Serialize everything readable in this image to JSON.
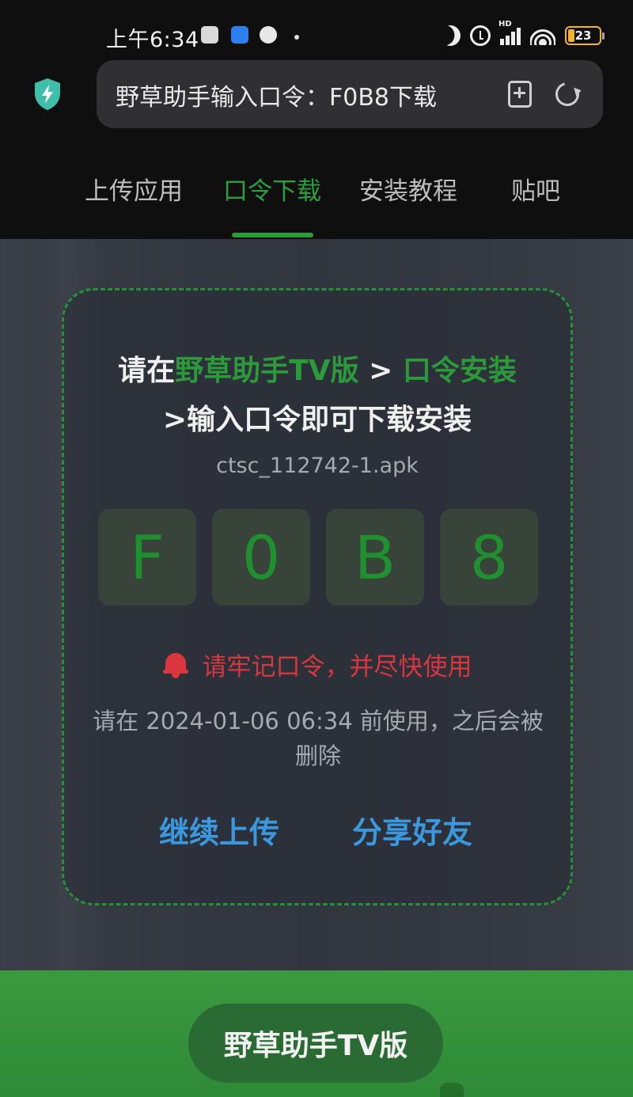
{
  "status_bar": {
    "time": "上午6:34",
    "battery": "23",
    "network": "HD"
  },
  "browser": {
    "url_text": "野草助手输入口令：F0B8下载"
  },
  "tabs": [
    {
      "label": "上传应用",
      "active": false
    },
    {
      "label": "口令下载",
      "active": true
    },
    {
      "label": "安装教程",
      "active": false
    },
    {
      "label": "贴吧",
      "active": false
    }
  ],
  "card": {
    "line1": {
      "prefix": "请在",
      "app": "野草助手TV版",
      "sep": " > ",
      "menu": "口令安装"
    },
    "line2": ">输入口令即可下载安装",
    "filename": "ctsc_112742-1.apk",
    "code": [
      "F",
      "0",
      "B",
      "8"
    ],
    "warning": "请牢记口令，并尽快使用",
    "expire": "请在 2024-01-06 06:34 前使用，之后会被删除",
    "continue_upload": "继续上传",
    "share_friends": "分享好友"
  },
  "bottom": {
    "button_label": "野草助手TV版"
  },
  "colors": {
    "accent_green": "#2c9a3a",
    "warning_red": "#d9363e",
    "link_blue": "#3b98de",
    "battery": "#f2b233"
  }
}
